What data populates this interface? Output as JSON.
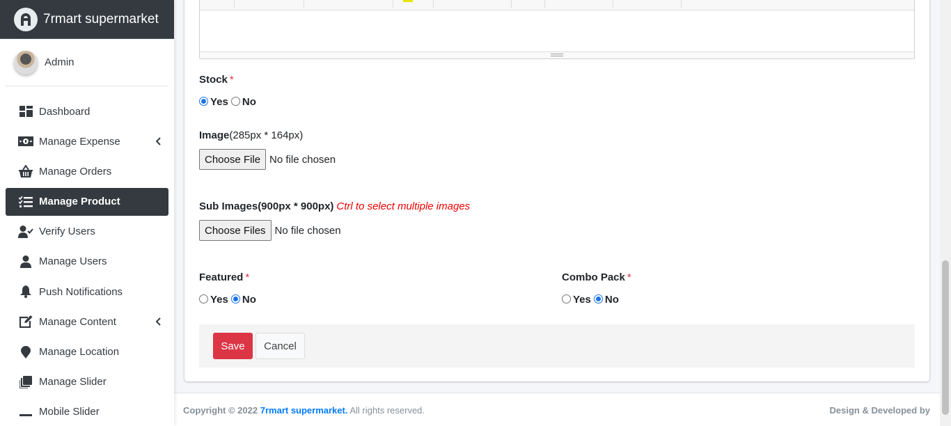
{
  "brand": {
    "name": "7rmart supermarket"
  },
  "user": {
    "name": "Admin"
  },
  "nav": {
    "items": [
      {
        "label": "Dashboard",
        "icon": "dashboard-icon"
      },
      {
        "label": "Manage Expense",
        "icon": "money-icon"
      },
      {
        "label": "Manage Orders",
        "icon": "basket-icon"
      },
      {
        "label": "Manage Product",
        "icon": "list-check-icon"
      },
      {
        "label": "Verify Users",
        "icon": "user-check-icon"
      },
      {
        "label": "Manage Users",
        "icon": "user-icon"
      },
      {
        "label": "Push Notifications",
        "icon": "bell-icon"
      },
      {
        "label": "Manage Content",
        "icon": "edit-icon"
      },
      {
        "label": "Manage Location",
        "icon": "map-marker-icon"
      },
      {
        "label": "Manage Slider",
        "icon": "slides-icon"
      },
      {
        "label": "Mobile Slider",
        "icon": "minus-icon"
      }
    ]
  },
  "form": {
    "stock": {
      "label": "Stock",
      "required": "*",
      "yes": "Yes",
      "no": "No",
      "selected": "Yes"
    },
    "image": {
      "label": "Image",
      "hint": "(285px * 164px)",
      "button": "Choose File",
      "status": "No file chosen"
    },
    "sub_images": {
      "label": "Sub Images(900px * 900px)",
      "hint": "Ctrl to select multiple images",
      "button": "Choose Files",
      "status": "No file chosen"
    },
    "featured": {
      "label": "Featured",
      "required": "*",
      "yes": "Yes",
      "no": "No",
      "selected": "No"
    },
    "combo": {
      "label": "Combo Pack",
      "required": "*",
      "yes": "Yes",
      "no": "No",
      "selected": "No"
    },
    "save": "Save",
    "cancel": "Cancel"
  },
  "footer": {
    "copyright": "Copyright © 2022",
    "brand_link": "7rmart supermarket.",
    "rights": "All rights reserved.",
    "credit": "Design & Developed by"
  },
  "colors": {
    "sidebar_dark": "#343a40",
    "danger": "#dc3545",
    "link": "#007bff",
    "radio": "#1a73e8"
  }
}
